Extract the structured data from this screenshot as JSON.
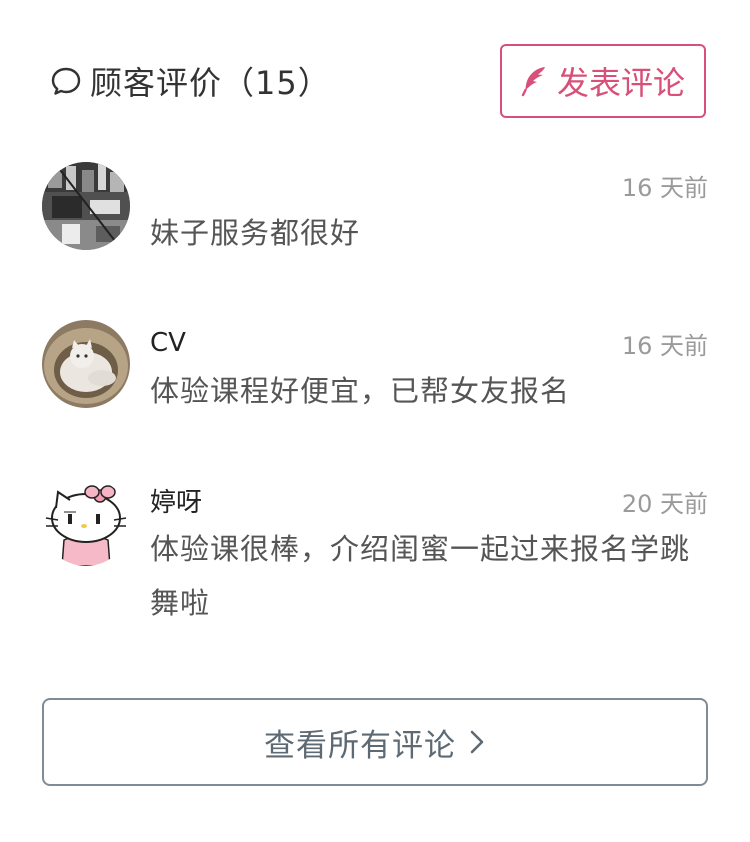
{
  "header": {
    "title": "顾客评价（15）",
    "post_button_label": "发表评论"
  },
  "colors": {
    "accent": "#d8507a",
    "border_gray": "#7f8c95",
    "time_gray": "#9a9a9a"
  },
  "reviews": [
    {
      "name": "",
      "time": "16 天前",
      "content": "妹子服务都很好",
      "avatar": "photo-avatar"
    },
    {
      "name": "CV",
      "time": "16 天前",
      "content": "体验课程好便宜，已帮女友报名",
      "avatar": "cat-avatar"
    },
    {
      "name": "婷呀",
      "time": "20 天前",
      "content": "体验课很棒，介绍闺蜜一起过来报名学跳舞啦",
      "avatar": "hello-kitty-avatar"
    }
  ],
  "view_all": {
    "label": "查看所有评论"
  }
}
